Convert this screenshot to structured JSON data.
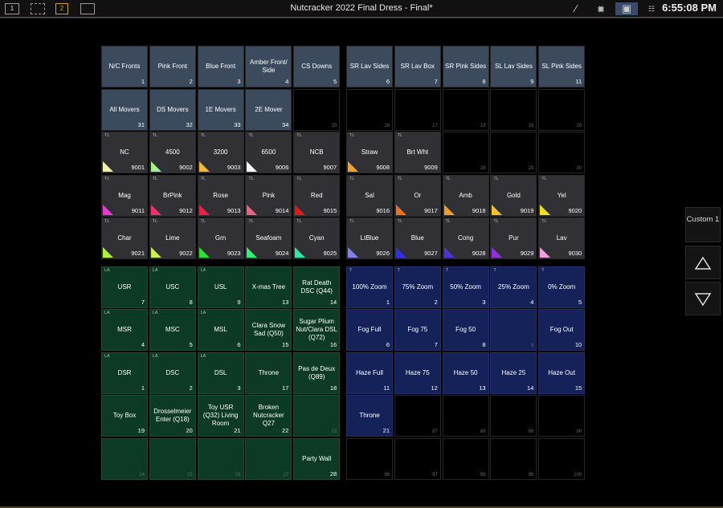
{
  "topbar": {
    "title": "Nutcracker 2022 Final Dress - Final*",
    "clock": "6:55:08 PM",
    "desk1": "1",
    "desk2": "2"
  },
  "side": {
    "custom_label": "Custom 1"
  },
  "colors": {
    "blue": "#3b4a5c",
    "green": "#0c3a24",
    "navy": "#15225a",
    "gray": "#303035"
  },
  "left_grid": [
    [
      {
        "l": "N/C Fronts",
        "n": "1",
        "t": "blue"
      },
      {
        "l": "Pink Front",
        "n": "2",
        "t": "blue"
      },
      {
        "l": "Blue Front",
        "n": "3",
        "t": "blue"
      },
      {
        "l": "Amber Front/ Side",
        "n": "4",
        "t": "blue"
      },
      {
        "l": "CS Downs",
        "n": "5",
        "t": "blue"
      }
    ],
    [
      {
        "l": "All Movers",
        "n": "31",
        "t": "blue"
      },
      {
        "l": "DS Movers",
        "n": "32",
        "t": "blue"
      },
      {
        "l": "1E Movers",
        "n": "33",
        "t": "blue"
      },
      {
        "l": "2E Mover",
        "n": "34",
        "t": "blue"
      },
      {
        "l": "",
        "n": "15",
        "t": "dark"
      }
    ],
    [
      {
        "l": "NC",
        "n": "9001",
        "t": "gray",
        "tag": "TL",
        "c": "#f5f0a8"
      },
      {
        "l": "4500",
        "n": "9002",
        "t": "gray",
        "tag": "TL",
        "c": "#a6f08c"
      },
      {
        "l": "3200",
        "n": "9003",
        "t": "gray",
        "tag": "TL",
        "c": "#f2b83a"
      },
      {
        "l": "6500",
        "n": "9006",
        "t": "gray",
        "tag": "TL",
        "c": "#ffffff"
      },
      {
        "l": "NCB",
        "n": "9007",
        "t": "gray",
        "tag": "TL"
      }
    ],
    [
      {
        "l": "Mag",
        "n": "9011",
        "t": "gray",
        "tag": "TL",
        "c": "#e83ad6"
      },
      {
        "l": "BrPink",
        "n": "9012",
        "t": "gray",
        "tag": "TL",
        "c": "#f0306a"
      },
      {
        "l": "Rose",
        "n": "9013",
        "t": "gray",
        "tag": "TL",
        "c": "#e8204a"
      },
      {
        "l": "Pink",
        "n": "9014",
        "t": "gray",
        "tag": "TL",
        "c": "#f06080"
      },
      {
        "l": "Red",
        "n": "9015",
        "t": "gray",
        "tag": "TL",
        "c": "#e01818"
      }
    ],
    [
      {
        "l": "Char",
        "n": "9021",
        "t": "gray",
        "tag": "TL",
        "c": "#b0f040"
      },
      {
        "l": "Lime",
        "n": "9022",
        "t": "gray",
        "tag": "TL",
        "c": "#c8f050"
      },
      {
        "l": "Grn",
        "n": "9023",
        "t": "gray",
        "tag": "TL",
        "c": "#30e030"
      },
      {
        "l": "Seafoam",
        "n": "9024",
        "t": "gray",
        "tag": "TL",
        "c": "#30f070"
      },
      {
        "l": "Cyan",
        "n": "9025",
        "t": "gray",
        "tag": "TL",
        "c": "#30e8a0"
      }
    ],
    [
      {
        "l": "USR",
        "n": "7",
        "t": "green",
        "tag": "LA"
      },
      {
        "l": "USC",
        "n": "8",
        "t": "green",
        "tag": "LA"
      },
      {
        "l": "USL",
        "n": "9",
        "t": "green",
        "tag": "LA"
      },
      {
        "l": "X-mas Tree",
        "n": "13",
        "t": "green"
      },
      {
        "l": "Rat Death DSC (Q44)",
        "n": "14",
        "t": "green"
      }
    ],
    [
      {
        "l": "MSR",
        "n": "4",
        "t": "green",
        "tag": "LA"
      },
      {
        "l": "MSC",
        "n": "5",
        "t": "green",
        "tag": "LA"
      },
      {
        "l": "MSL",
        "n": "6",
        "t": "green",
        "tag": "LA"
      },
      {
        "l": "Clara Snow Sad (Q50)",
        "n": "15",
        "t": "green"
      },
      {
        "l": "Sugar Plium Nut/Clara DSL (Q72)",
        "n": "16",
        "t": "green"
      }
    ],
    [
      {
        "l": "DSR",
        "n": "1",
        "t": "green",
        "tag": "LA"
      },
      {
        "l": "DSC",
        "n": "2",
        "t": "green",
        "tag": "LA"
      },
      {
        "l": "DSL",
        "n": "3",
        "t": "green",
        "tag": "LA"
      },
      {
        "l": "Throne",
        "n": "17",
        "t": "green"
      },
      {
        "l": "Pas de Deux (Q89)",
        "n": "18",
        "t": "green"
      }
    ],
    [
      {
        "l": "Toy Box",
        "n": "19",
        "t": "green"
      },
      {
        "l": "Drosselmeier Enter (Q18)",
        "n": "20",
        "t": "green"
      },
      {
        "l": "Toy USR (Q32) Living Room",
        "n": "21",
        "t": "green"
      },
      {
        "l": "Broken Nutcracker Q27",
        "n": "22",
        "t": "green"
      },
      {
        "l": "",
        "n": "23",
        "t": "green",
        "dim": true
      }
    ],
    [
      {
        "l": "",
        "n": "24",
        "t": "green",
        "dim": true
      },
      {
        "l": "",
        "n": "25",
        "t": "green",
        "dim": true
      },
      {
        "l": "",
        "n": "26",
        "t": "green",
        "dim": true
      },
      {
        "l": "",
        "n": "27",
        "t": "green",
        "dim": true
      },
      {
        "l": "Party Wall",
        "n": "28",
        "t": "green"
      }
    ]
  ],
  "right_grid": [
    [
      {
        "l": "SR Lav Sides",
        "n": "6",
        "t": "blue"
      },
      {
        "l": "SR Lav Box",
        "n": "7",
        "t": "blue"
      },
      {
        "l": "SR Pink Sides",
        "n": "8",
        "t": "blue"
      },
      {
        "l": "SL Lav Sides",
        "n": "9",
        "t": "blue"
      },
      {
        "l": "SL Pink Sides",
        "n": "11",
        "t": "blue"
      }
    ],
    [
      {
        "l": "",
        "n": "16",
        "t": "dark"
      },
      {
        "l": "",
        "n": "17",
        "t": "dark"
      },
      {
        "l": "",
        "n": "18",
        "t": "dark"
      },
      {
        "l": "",
        "n": "19",
        "t": "dark"
      },
      {
        "l": "",
        "n": "20",
        "t": "dark"
      }
    ],
    [
      {
        "l": "Straw",
        "n": "9008",
        "t": "gray",
        "tag": "TL",
        "c": "#f2a030"
      },
      {
        "l": "Brt Wht",
        "n": "9009",
        "t": "gray",
        "tag": "TL"
      },
      {
        "l": "",
        "n": "28",
        "t": "dark"
      },
      {
        "l": "",
        "n": "29",
        "t": "dark"
      },
      {
        "l": "",
        "n": "30",
        "t": "dark"
      }
    ],
    [
      {
        "l": "Sal",
        "n": "9016",
        "t": "gray",
        "tag": "TL"
      },
      {
        "l": "Or",
        "n": "9017",
        "t": "gray",
        "tag": "TL",
        "c": "#f07020"
      },
      {
        "l": "Amb",
        "n": "9018",
        "t": "gray",
        "tag": "TL",
        "c": "#f09a30"
      },
      {
        "l": "Gold",
        "n": "9019",
        "t": "gray",
        "tag": "TL",
        "c": "#f0c030"
      },
      {
        "l": "Yel",
        "n": "9020",
        "t": "gray",
        "tag": "TL",
        "c": "#f0e020"
      }
    ],
    [
      {
        "l": "LtBlue",
        "n": "9026",
        "t": "gray",
        "tag": "TL",
        "c": "#8080f0"
      },
      {
        "l": "Blue",
        "n": "9027",
        "t": "gray",
        "tag": "TL",
        "c": "#3030f0"
      },
      {
        "l": "Cong",
        "n": "9028",
        "t": "gray",
        "tag": "TL",
        "c": "#5030e0"
      },
      {
        "l": "Pur",
        "n": "9029",
        "t": "gray",
        "tag": "TL",
        "c": "#9030e0"
      },
      {
        "l": "Lav",
        "n": "9030",
        "t": "gray",
        "tag": "TL",
        "c": "#f0a0e0"
      }
    ],
    [
      {
        "l": "100% Zoom",
        "n": "1",
        "t": "navy",
        "tag": "T"
      },
      {
        "l": "75% Zoom",
        "n": "2",
        "t": "navy",
        "tag": "T"
      },
      {
        "l": "50% Zoom",
        "n": "3",
        "t": "navy",
        "tag": "T"
      },
      {
        "l": "25% Zoom",
        "n": "4",
        "t": "navy",
        "tag": "T"
      },
      {
        "l": "0% Zoom",
        "n": "5",
        "t": "navy",
        "tag": "T"
      }
    ],
    [
      {
        "l": "Fog Full",
        "n": "6",
        "t": "navy"
      },
      {
        "l": "Fog 75",
        "n": "7",
        "t": "navy"
      },
      {
        "l": "Fog 50",
        "n": "8",
        "t": "navy"
      },
      {
        "l": "",
        "n": "9",
        "t": "navy",
        "dim": true
      },
      {
        "l": "Fog Out",
        "n": "10",
        "t": "navy"
      }
    ],
    [
      {
        "l": "Haze Full",
        "n": "11",
        "t": "navy"
      },
      {
        "l": "Haze 75",
        "n": "12",
        "t": "navy"
      },
      {
        "l": "Haze 50",
        "n": "13",
        "t": "navy"
      },
      {
        "l": "Haze 25",
        "n": "14",
        "t": "navy"
      },
      {
        "l": "Haze Out",
        "n": "15",
        "t": "navy"
      }
    ],
    [
      {
        "l": "Throne",
        "n": "21",
        "t": "navy"
      },
      {
        "l": "",
        "n": "87",
        "t": "dark"
      },
      {
        "l": "",
        "n": "88",
        "t": "dark"
      },
      {
        "l": "",
        "n": "89",
        "t": "dark"
      },
      {
        "l": "",
        "n": "90",
        "t": "dark"
      }
    ],
    [
      {
        "l": "",
        "n": "96",
        "t": "dark"
      },
      {
        "l": "",
        "n": "97",
        "t": "dark"
      },
      {
        "l": "",
        "n": "98",
        "t": "dark"
      },
      {
        "l": "",
        "n": "99",
        "t": "dark"
      },
      {
        "l": "",
        "n": "100",
        "t": "dark"
      }
    ]
  ]
}
